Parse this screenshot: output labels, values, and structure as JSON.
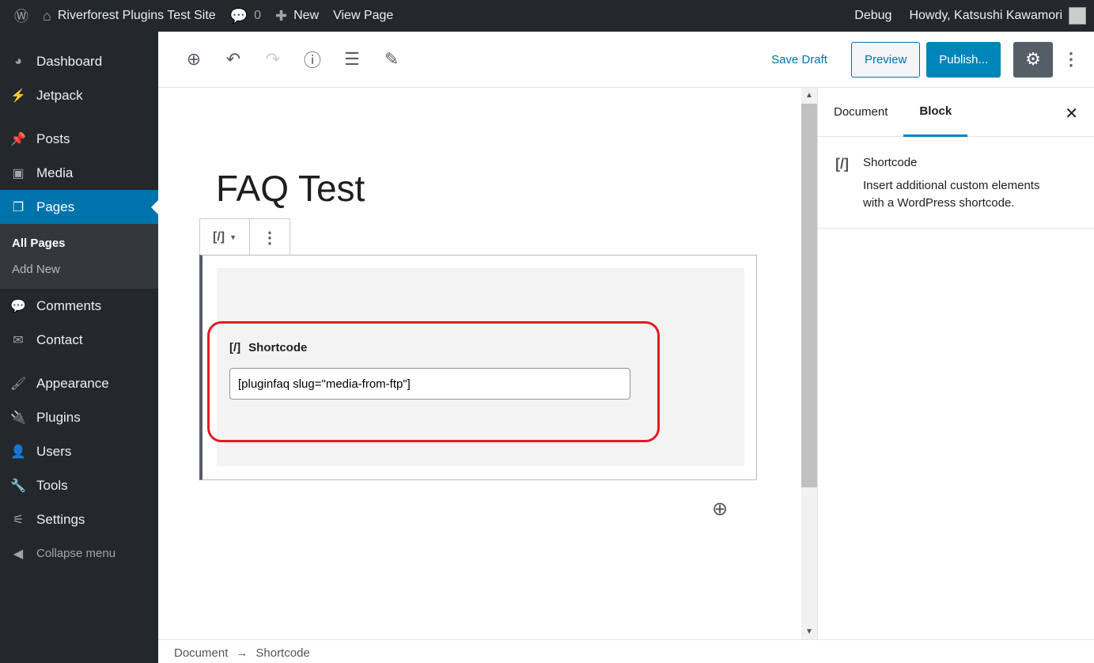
{
  "adminbar": {
    "site": "Riverforest Plugins Test Site",
    "comments": "0",
    "new": "New",
    "view": "View Page",
    "debug": "Debug",
    "howdy": "Howdy, Katsushi Kawamori"
  },
  "sidebar": {
    "items": [
      "Dashboard",
      "Jetpack",
      "Posts",
      "Media",
      "Pages",
      "Comments",
      "Contact",
      "Appearance",
      "Plugins",
      "Users",
      "Tools",
      "Settings",
      "Collapse menu"
    ],
    "sub": [
      "All Pages",
      "Add New"
    ]
  },
  "toolbar": {
    "save_draft": "Save Draft",
    "preview": "Preview",
    "publish": "Publish..."
  },
  "editor": {
    "title": "FAQ Test",
    "block_icon": "[/]",
    "block_label": "Shortcode",
    "shortcode_value": "[pluginfaq slug=\"media-from-ftp\"]"
  },
  "panel": {
    "tab_document": "Document",
    "tab_block": "Block",
    "block_name": "Shortcode",
    "block_desc": "Insert additional custom elements with a WordPress shortcode."
  },
  "footer": {
    "crumb1": "Document",
    "arrow": "→",
    "crumb2": "Shortcode"
  },
  "colors": {
    "accent": "#0085ba",
    "admin_bg": "#23282d",
    "highlight": "#e31b23"
  }
}
